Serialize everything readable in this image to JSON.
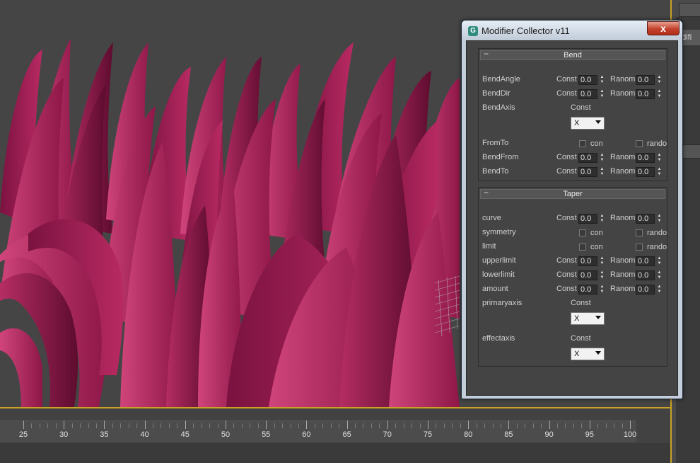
{
  "window": {
    "title": "Modifier Collector v11",
    "close_label": "x",
    "icon_letter": "G"
  },
  "command_panel": {
    "tab_label": "odifi"
  },
  "timeline": {
    "labels": [
      "25",
      "30",
      "35",
      "40",
      "45",
      "50",
      "55",
      "60",
      "65",
      "70",
      "75",
      "80",
      "85",
      "90",
      "95",
      "100"
    ]
  },
  "bend": {
    "title": "Bend",
    "collapse": "−",
    "bendangle": {
      "label": "BendAngle",
      "mode": "Const",
      "value": "0.0",
      "rand_label": "Ranom",
      "rand_value": "0.0"
    },
    "benddir": {
      "label": "BendDir",
      "mode": "Const",
      "value": "0.0",
      "rand_label": "Ranom",
      "rand_value": "0.0"
    },
    "bendaxis": {
      "label": "BendAxis",
      "mode": "Const",
      "selected": "X"
    },
    "fromto": {
      "label": "FromTo",
      "con_label": "con",
      "rand_label": "rando"
    },
    "bendfrom": {
      "label": "BendFrom",
      "mode": "Const",
      "value": "0.0",
      "rand_label": "Ranom",
      "rand_value": "0.0"
    },
    "bendto": {
      "label": "BendTo",
      "mode": "Const",
      "value": "0.0",
      "rand_label": "Ranom",
      "rand_value": "0.0"
    }
  },
  "taper": {
    "title": "Taper",
    "collapse": "−",
    "curve": {
      "label": "curve",
      "mode": "Const",
      "value": "0.0",
      "rand_label": "Ranom",
      "rand_value": "0.0"
    },
    "symmetry": {
      "label": "symmetry",
      "con_label": "con",
      "rand_label": "rando"
    },
    "limit": {
      "label": "limit",
      "con_label": "con",
      "rand_label": "rando"
    },
    "upperlimit": {
      "label": "upperlimit",
      "mode": "Const",
      "value": "0.0",
      "rand_label": "Ranom",
      "rand_value": "0.0"
    },
    "lowerlimit": {
      "label": "lowerlimit",
      "mode": "Const",
      "value": "0.0",
      "rand_label": "Ranom",
      "rand_value": "0.0"
    },
    "amount": {
      "label": "amount",
      "mode": "Const",
      "value": "0.0",
      "rand_label": "Ranom",
      "rand_value": "0.0"
    },
    "primaryaxis": {
      "label": "primaryaxis",
      "mode": "Const",
      "selected": "X"
    },
    "effectaxis": {
      "label": "effectaxis",
      "mode": "Const",
      "selected": "X"
    }
  },
  "colors": {
    "leaf_light": "#c8386e",
    "leaf_mid": "#a11e55",
    "leaf_dark": "#6e0f36",
    "viewport_bg": "#454545"
  }
}
